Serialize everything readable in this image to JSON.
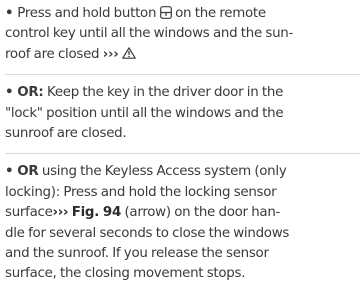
{
  "p1": {
    "l1_a": "Press and hold button",
    "l1_b": "on the remote",
    "l2": "control key until all the windows and the sun-",
    "l3_a": "roof are closed",
    "arrows": "›››"
  },
  "p2": {
    "or": "OR:",
    "l1_rest": "Keep the key in the driver door in the",
    "l2": "\"lock\" position until all the windows and the",
    "l3": "sunroof are closed."
  },
  "p3": {
    "or": "OR",
    "l1_rest": "using the Keyless Access system (only",
    "l2": "locking): Press and hold the locking sensor",
    "l3_a": "surface",
    "arrows": "›››",
    "fig_ref": "Fig. 94",
    "l3_b": "(arrow) on the door han-",
    "l4": "dle for several seconds to close the windows",
    "l5": "and the sunroof. If you release the sensor",
    "l6": "surface, the closing movement stops."
  },
  "icons": {
    "lock_button": "remote-lock-button-icon",
    "warning": "warning-triangle-icon"
  }
}
